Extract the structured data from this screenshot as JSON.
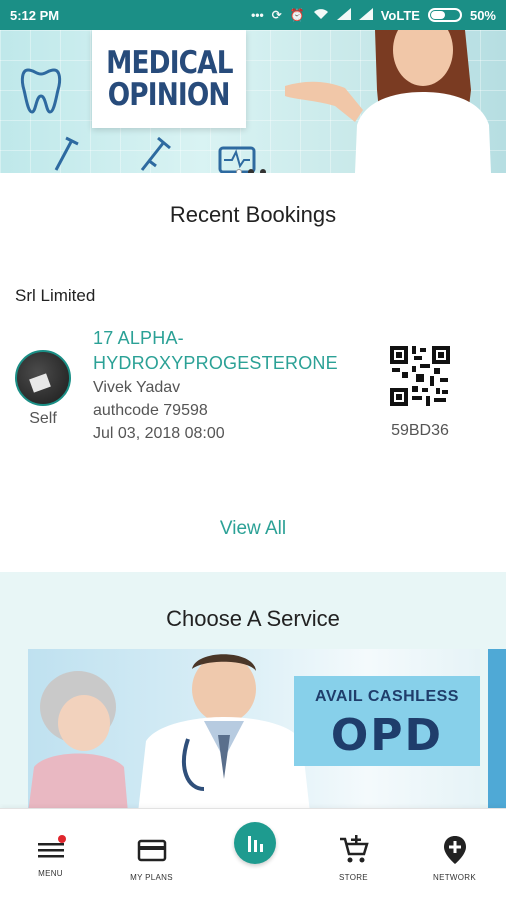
{
  "status_bar": {
    "time": "5:12 PM",
    "network_label": "VoLTE",
    "battery": "50%",
    "battery_level": 0.5
  },
  "banner": {
    "board_lines": [
      "MEDICAL",
      "OPINION"
    ],
    "slide_count": 3,
    "active_slide": 0
  },
  "recent_bookings": {
    "title": "Recent Bookings",
    "company": "Srl Limited",
    "booking": {
      "avatar_label": "Self",
      "test_line1": "17 ALPHA-",
      "test_line2": "HYDROXYPROGESTERONE",
      "patient": "Vivek  Yadav",
      "authcode": "authcode 79598",
      "datetime": "Jul 03, 2018 08:00",
      "qr_code": "59BD36"
    },
    "view_all": "View All"
  },
  "service": {
    "title": "Choose A Service",
    "card": {
      "line1": "AVAIL CASHLESS",
      "line2": "OPD"
    }
  },
  "bottom_nav": {
    "items": [
      {
        "label": "MENU",
        "icon": "hamburger-icon"
      },
      {
        "label": "MY PLANS",
        "icon": "card-icon"
      },
      {
        "label": "",
        "icon": "bar-chart-icon"
      },
      {
        "label": "STORE",
        "icon": "cart-add-icon"
      },
      {
        "label": "NETWORK",
        "icon": "location-plus-icon"
      }
    ]
  },
  "colors": {
    "brand_teal": "#1b8f86",
    "link_teal": "#2ba196",
    "opd_navy": "#1f3d6b"
  }
}
